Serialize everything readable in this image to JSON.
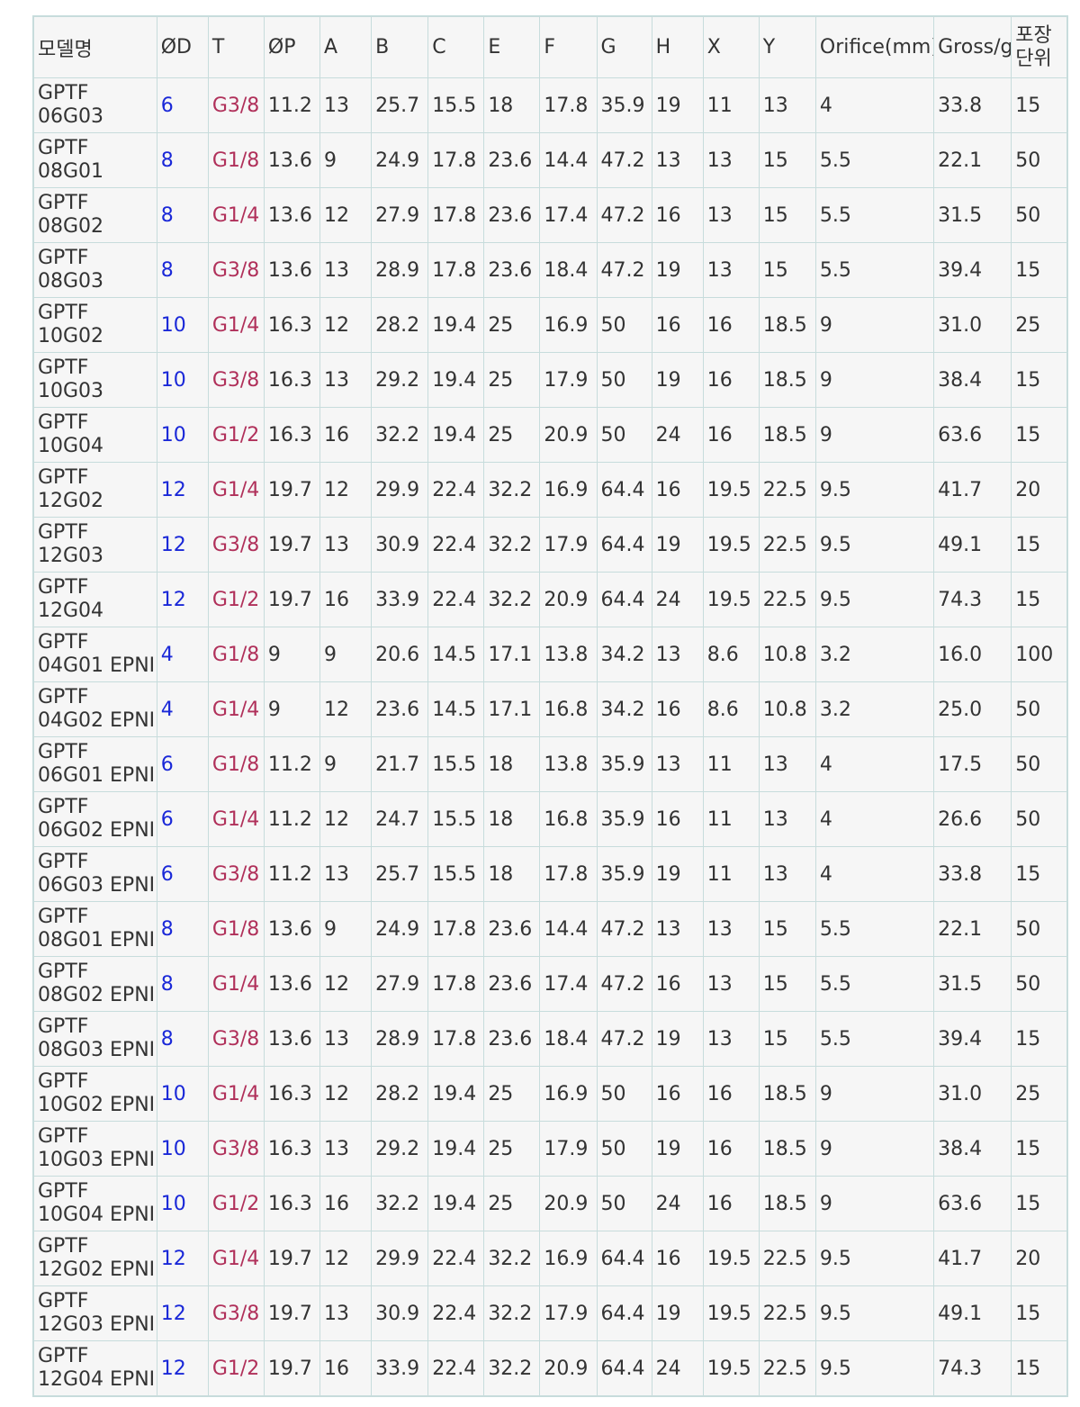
{
  "colors": {
    "od_text": "#1a28d8",
    "thread_text": "#b0305a",
    "border": "#c7dcdc",
    "cell_bg": "#f6f6f6"
  },
  "headers": [
    "모델명",
    "ØD",
    "T",
    "ØP",
    "A",
    "B",
    "C",
    "E",
    "F",
    "G",
    "H",
    "X",
    "Y",
    "Orifice(mm)",
    "Gross/g",
    "포장\n단위"
  ],
  "header_pack_lines": [
    "포장",
    "단위"
  ],
  "rows": [
    {
      "model": [
        "GPTF",
        "06G03"
      ],
      "cells": [
        "6",
        "G3/8",
        "11.2",
        "13",
        "25.7",
        "15.5",
        "18",
        "17.8",
        "35.9",
        "19",
        "11",
        "13",
        "4",
        "33.8",
        "15"
      ]
    },
    {
      "model": [
        "GPTF",
        "08G01"
      ],
      "cells": [
        "8",
        "G1/8",
        "13.6",
        "9",
        "24.9",
        "17.8",
        "23.6",
        "14.4",
        "47.2",
        "13",
        "13",
        "15",
        "5.5",
        "22.1",
        "50"
      ]
    },
    {
      "model": [
        "GPTF",
        "08G02"
      ],
      "cells": [
        "8",
        "G1/4",
        "13.6",
        "12",
        "27.9",
        "17.8",
        "23.6",
        "17.4",
        "47.2",
        "16",
        "13",
        "15",
        "5.5",
        "31.5",
        "50"
      ]
    },
    {
      "model": [
        "GPTF",
        "08G03"
      ],
      "cells": [
        "8",
        "G3/8",
        "13.6",
        "13",
        "28.9",
        "17.8",
        "23.6",
        "18.4",
        "47.2",
        "19",
        "13",
        "15",
        "5.5",
        "39.4",
        "15"
      ]
    },
    {
      "model": [
        "GPTF",
        "10G02"
      ],
      "cells": [
        "10",
        "G1/4",
        "16.3",
        "12",
        "28.2",
        "19.4",
        "25",
        "16.9",
        "50",
        "16",
        "16",
        "18.5",
        "9",
        "31.0",
        "25"
      ]
    },
    {
      "model": [
        "GPTF",
        "10G03"
      ],
      "cells": [
        "10",
        "G3/8",
        "16.3",
        "13",
        "29.2",
        "19.4",
        "25",
        "17.9",
        "50",
        "19",
        "16",
        "18.5",
        "9",
        "38.4",
        "15"
      ]
    },
    {
      "model": [
        "GPTF",
        "10G04"
      ],
      "cells": [
        "10",
        "G1/2",
        "16.3",
        "16",
        "32.2",
        "19.4",
        "25",
        "20.9",
        "50",
        "24",
        "16",
        "18.5",
        "9",
        "63.6",
        "15"
      ]
    },
    {
      "model": [
        "GPTF",
        "12G02"
      ],
      "cells": [
        "12",
        "G1/4",
        "19.7",
        "12",
        "29.9",
        "22.4",
        "32.2",
        "16.9",
        "64.4",
        "16",
        "19.5",
        "22.5",
        "9.5",
        "41.7",
        "20"
      ]
    },
    {
      "model": [
        "GPTF",
        "12G03"
      ],
      "cells": [
        "12",
        "G3/8",
        "19.7",
        "13",
        "30.9",
        "22.4",
        "32.2",
        "17.9",
        "64.4",
        "19",
        "19.5",
        "22.5",
        "9.5",
        "49.1",
        "15"
      ]
    },
    {
      "model": [
        "GPTF",
        "12G04"
      ],
      "cells": [
        "12",
        "G1/2",
        "19.7",
        "16",
        "33.9",
        "22.4",
        "32.2",
        "20.9",
        "64.4",
        "24",
        "19.5",
        "22.5",
        "9.5",
        "74.3",
        "15"
      ]
    },
    {
      "model": [
        "GPTF",
        "04G01 EPNI"
      ],
      "cells": [
        "4",
        "G1/8",
        "9",
        "9",
        "20.6",
        "14.5",
        "17.1",
        "13.8",
        "34.2",
        "13",
        "8.6",
        "10.8",
        "3.2",
        "16.0",
        "100"
      ]
    },
    {
      "model": [
        "GPTF",
        "04G02 EPNI"
      ],
      "cells": [
        "4",
        "G1/4",
        "9",
        "12",
        "23.6",
        "14.5",
        "17.1",
        "16.8",
        "34.2",
        "16",
        "8.6",
        "10.8",
        "3.2",
        "25.0",
        "50"
      ]
    },
    {
      "model": [
        "GPTF",
        "06G01 EPNI"
      ],
      "cells": [
        "6",
        "G1/8",
        "11.2",
        "9",
        "21.7",
        "15.5",
        "18",
        "13.8",
        "35.9",
        "13",
        "11",
        "13",
        "4",
        "17.5",
        "50"
      ]
    },
    {
      "model": [
        "GPTF",
        "06G02 EPNI"
      ],
      "cells": [
        "6",
        "G1/4",
        "11.2",
        "12",
        "24.7",
        "15.5",
        "18",
        "16.8",
        "35.9",
        "16",
        "11",
        "13",
        "4",
        "26.6",
        "50"
      ]
    },
    {
      "model": [
        "GPTF",
        "06G03 EPNI"
      ],
      "cells": [
        "6",
        "G3/8",
        "11.2",
        "13",
        "25.7",
        "15.5",
        "18",
        "17.8",
        "35.9",
        "19",
        "11",
        "13",
        "4",
        "33.8",
        "15"
      ]
    },
    {
      "model": [
        "GPTF",
        "08G01 EPNI"
      ],
      "cells": [
        "8",
        "G1/8",
        "13.6",
        "9",
        "24.9",
        "17.8",
        "23.6",
        "14.4",
        "47.2",
        "13",
        "13",
        "15",
        "5.5",
        "22.1",
        "50"
      ]
    },
    {
      "model": [
        "GPTF",
        "08G02 EPNI"
      ],
      "cells": [
        "8",
        "G1/4",
        "13.6",
        "12",
        "27.9",
        "17.8",
        "23.6",
        "17.4",
        "47.2",
        "16",
        "13",
        "15",
        "5.5",
        "31.5",
        "50"
      ]
    },
    {
      "model": [
        "GPTF",
        "08G03 EPNI"
      ],
      "cells": [
        "8",
        "G3/8",
        "13.6",
        "13",
        "28.9",
        "17.8",
        "23.6",
        "18.4",
        "47.2",
        "19",
        "13",
        "15",
        "5.5",
        "39.4",
        "15"
      ]
    },
    {
      "model": [
        "GPTF",
        "10G02 EPNI"
      ],
      "cells": [
        "10",
        "G1/4",
        "16.3",
        "12",
        "28.2",
        "19.4",
        "25",
        "16.9",
        "50",
        "16",
        "16",
        "18.5",
        "9",
        "31.0",
        "25"
      ]
    },
    {
      "model": [
        "GPTF",
        "10G03 EPNI"
      ],
      "cells": [
        "10",
        "G3/8",
        "16.3",
        "13",
        "29.2",
        "19.4",
        "25",
        "17.9",
        "50",
        "19",
        "16",
        "18.5",
        "9",
        "38.4",
        "15"
      ]
    },
    {
      "model": [
        "GPTF",
        "10G04 EPNI"
      ],
      "cells": [
        "10",
        "G1/2",
        "16.3",
        "16",
        "32.2",
        "19.4",
        "25",
        "20.9",
        "50",
        "24",
        "16",
        "18.5",
        "9",
        "63.6",
        "15"
      ]
    },
    {
      "model": [
        "GPTF",
        "12G02 EPNI"
      ],
      "cells": [
        "12",
        "G1/4",
        "19.7",
        "12",
        "29.9",
        "22.4",
        "32.2",
        "16.9",
        "64.4",
        "16",
        "19.5",
        "22.5",
        "9.5",
        "41.7",
        "20"
      ]
    },
    {
      "model": [
        "GPTF",
        "12G03 EPNI"
      ],
      "cells": [
        "12",
        "G3/8",
        "19.7",
        "13",
        "30.9",
        "22.4",
        "32.2",
        "17.9",
        "64.4",
        "19",
        "19.5",
        "22.5",
        "9.5",
        "49.1",
        "15"
      ]
    },
    {
      "model": [
        "GPTF",
        "12G04 EPNI"
      ],
      "cells": [
        "12",
        "G1/2",
        "19.7",
        "16",
        "33.9",
        "22.4",
        "32.2",
        "20.9",
        "64.4",
        "24",
        "19.5",
        "22.5",
        "9.5",
        "74.3",
        "15"
      ]
    }
  ]
}
